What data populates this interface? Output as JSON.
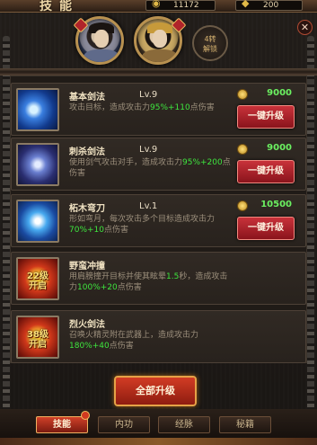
{
  "header": {
    "title": "技能",
    "currency1_value": "11172",
    "currency2_value": "200",
    "close_label": "✕"
  },
  "characters": {
    "unlock_text": "4转\n解锁"
  },
  "skills": [
    {
      "name": "基本剑法",
      "level": "Lv.9",
      "desc_parts": [
        {
          "t": "攻击目标，造成攻击力",
          "hl": false
        },
        {
          "t": "95%+110",
          "hl": true
        },
        {
          "t": "点伤害",
          "hl": false
        }
      ],
      "cost": "9000",
      "button": "一键升级",
      "icon": "blue-sword-icon",
      "locked": false
    },
    {
      "name": "刺杀剑法",
      "level": "Lv.9",
      "desc_parts": [
        {
          "t": "使用剑气攻击对手，造成攻击力",
          "hl": false
        },
        {
          "t": "95%+200",
          "hl": true
        },
        {
          "t": "点伤害",
          "hl": false
        }
      ],
      "cost": "9000",
      "button": "一键升级",
      "icon": "slash-icon",
      "locked": false
    },
    {
      "name": "柘木弯刀",
      "level": "Lv.1",
      "desc_parts": [
        {
          "t": "形如弯月，每次攻击多个目标造成攻击力",
          "hl": false
        },
        {
          "t": "70%+10",
          "hl": true
        },
        {
          "t": "点伤害",
          "hl": false
        }
      ],
      "cost": "10500",
      "button": "一键升级",
      "icon": "crescent-blade-icon",
      "locked": false
    },
    {
      "name": "野蛮冲撞",
      "level": "",
      "desc_parts": [
        {
          "t": "用肩膀撞开目标并使其眩晕",
          "hl": false
        },
        {
          "t": "1.5",
          "hl": true
        },
        {
          "t": "秒，造成攻击力",
          "hl": false
        },
        {
          "t": "100%+20",
          "hl": true
        },
        {
          "t": "点伤害",
          "hl": false
        }
      ],
      "cost": "",
      "button": "",
      "icon": "charge-icon",
      "locked": true,
      "lock_text": "22级\n开启"
    },
    {
      "name": "烈火剑法",
      "level": "",
      "desc_parts": [
        {
          "t": "召唤火精灵附在武器上，造成攻击力",
          "hl": false
        },
        {
          "t": "180%+40",
          "hl": true
        },
        {
          "t": "点伤害",
          "hl": false
        }
      ],
      "cost": "",
      "button": "",
      "icon": "fire-sword-icon",
      "locked": true,
      "lock_text": "38级\n开启"
    }
  ],
  "actions": {
    "upgrade_all": "全部升级"
  },
  "tabs": [
    {
      "label": "技能",
      "active": true
    },
    {
      "label": "内功",
      "active": false
    },
    {
      "label": "经脉",
      "active": false
    },
    {
      "label": "秘籍",
      "active": false
    }
  ]
}
